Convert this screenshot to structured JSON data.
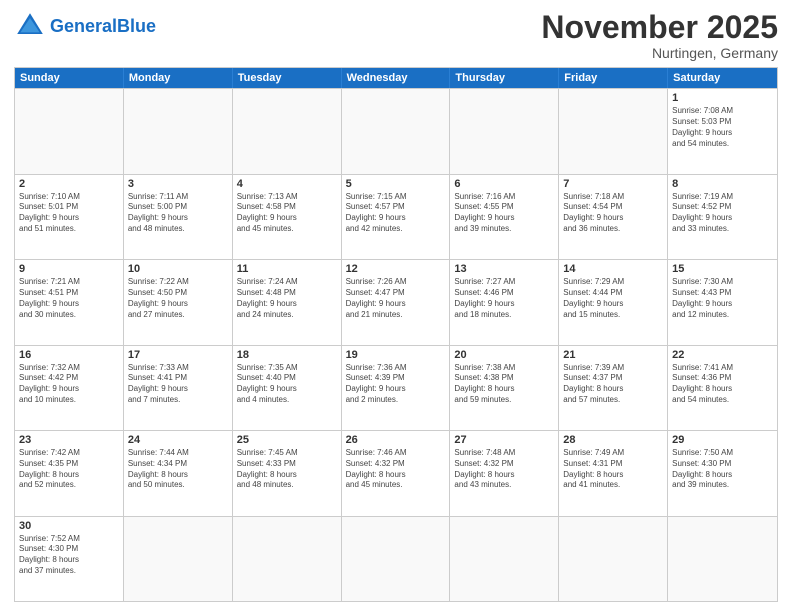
{
  "header": {
    "logo_general": "General",
    "logo_blue": "Blue",
    "month_title": "November 2025",
    "location": "Nurtingen, Germany"
  },
  "weekdays": [
    "Sunday",
    "Monday",
    "Tuesday",
    "Wednesday",
    "Thursday",
    "Friday",
    "Saturday"
  ],
  "weeks": [
    [
      {
        "day": "",
        "info": ""
      },
      {
        "day": "",
        "info": ""
      },
      {
        "day": "",
        "info": ""
      },
      {
        "day": "",
        "info": ""
      },
      {
        "day": "",
        "info": ""
      },
      {
        "day": "",
        "info": ""
      },
      {
        "day": "1",
        "info": "Sunrise: 7:08 AM\nSunset: 5:03 PM\nDaylight: 9 hours\nand 54 minutes."
      }
    ],
    [
      {
        "day": "2",
        "info": "Sunrise: 7:10 AM\nSunset: 5:01 PM\nDaylight: 9 hours\nand 51 minutes."
      },
      {
        "day": "3",
        "info": "Sunrise: 7:11 AM\nSunset: 5:00 PM\nDaylight: 9 hours\nand 48 minutes."
      },
      {
        "day": "4",
        "info": "Sunrise: 7:13 AM\nSunset: 4:58 PM\nDaylight: 9 hours\nand 45 minutes."
      },
      {
        "day": "5",
        "info": "Sunrise: 7:15 AM\nSunset: 4:57 PM\nDaylight: 9 hours\nand 42 minutes."
      },
      {
        "day": "6",
        "info": "Sunrise: 7:16 AM\nSunset: 4:55 PM\nDaylight: 9 hours\nand 39 minutes."
      },
      {
        "day": "7",
        "info": "Sunrise: 7:18 AM\nSunset: 4:54 PM\nDaylight: 9 hours\nand 36 minutes."
      },
      {
        "day": "8",
        "info": "Sunrise: 7:19 AM\nSunset: 4:52 PM\nDaylight: 9 hours\nand 33 minutes."
      }
    ],
    [
      {
        "day": "9",
        "info": "Sunrise: 7:21 AM\nSunset: 4:51 PM\nDaylight: 9 hours\nand 30 minutes."
      },
      {
        "day": "10",
        "info": "Sunrise: 7:22 AM\nSunset: 4:50 PM\nDaylight: 9 hours\nand 27 minutes."
      },
      {
        "day": "11",
        "info": "Sunrise: 7:24 AM\nSunset: 4:48 PM\nDaylight: 9 hours\nand 24 minutes."
      },
      {
        "day": "12",
        "info": "Sunrise: 7:26 AM\nSunset: 4:47 PM\nDaylight: 9 hours\nand 21 minutes."
      },
      {
        "day": "13",
        "info": "Sunrise: 7:27 AM\nSunset: 4:46 PM\nDaylight: 9 hours\nand 18 minutes."
      },
      {
        "day": "14",
        "info": "Sunrise: 7:29 AM\nSunset: 4:44 PM\nDaylight: 9 hours\nand 15 minutes."
      },
      {
        "day": "15",
        "info": "Sunrise: 7:30 AM\nSunset: 4:43 PM\nDaylight: 9 hours\nand 12 minutes."
      }
    ],
    [
      {
        "day": "16",
        "info": "Sunrise: 7:32 AM\nSunset: 4:42 PM\nDaylight: 9 hours\nand 10 minutes."
      },
      {
        "day": "17",
        "info": "Sunrise: 7:33 AM\nSunset: 4:41 PM\nDaylight: 9 hours\nand 7 minutes."
      },
      {
        "day": "18",
        "info": "Sunrise: 7:35 AM\nSunset: 4:40 PM\nDaylight: 9 hours\nand 4 minutes."
      },
      {
        "day": "19",
        "info": "Sunrise: 7:36 AM\nSunset: 4:39 PM\nDaylight: 9 hours\nand 2 minutes."
      },
      {
        "day": "20",
        "info": "Sunrise: 7:38 AM\nSunset: 4:38 PM\nDaylight: 8 hours\nand 59 minutes."
      },
      {
        "day": "21",
        "info": "Sunrise: 7:39 AM\nSunset: 4:37 PM\nDaylight: 8 hours\nand 57 minutes."
      },
      {
        "day": "22",
        "info": "Sunrise: 7:41 AM\nSunset: 4:36 PM\nDaylight: 8 hours\nand 54 minutes."
      }
    ],
    [
      {
        "day": "23",
        "info": "Sunrise: 7:42 AM\nSunset: 4:35 PM\nDaylight: 8 hours\nand 52 minutes."
      },
      {
        "day": "24",
        "info": "Sunrise: 7:44 AM\nSunset: 4:34 PM\nDaylight: 8 hours\nand 50 minutes."
      },
      {
        "day": "25",
        "info": "Sunrise: 7:45 AM\nSunset: 4:33 PM\nDaylight: 8 hours\nand 48 minutes."
      },
      {
        "day": "26",
        "info": "Sunrise: 7:46 AM\nSunset: 4:32 PM\nDaylight: 8 hours\nand 45 minutes."
      },
      {
        "day": "27",
        "info": "Sunrise: 7:48 AM\nSunset: 4:32 PM\nDaylight: 8 hours\nand 43 minutes."
      },
      {
        "day": "28",
        "info": "Sunrise: 7:49 AM\nSunset: 4:31 PM\nDaylight: 8 hours\nand 41 minutes."
      },
      {
        "day": "29",
        "info": "Sunrise: 7:50 AM\nSunset: 4:30 PM\nDaylight: 8 hours\nand 39 minutes."
      }
    ],
    [
      {
        "day": "30",
        "info": "Sunrise: 7:52 AM\nSunset: 4:30 PM\nDaylight: 8 hours\nand 37 minutes."
      },
      {
        "day": "",
        "info": ""
      },
      {
        "day": "",
        "info": ""
      },
      {
        "day": "",
        "info": ""
      },
      {
        "day": "",
        "info": ""
      },
      {
        "day": "",
        "info": ""
      },
      {
        "day": "",
        "info": ""
      }
    ]
  ]
}
